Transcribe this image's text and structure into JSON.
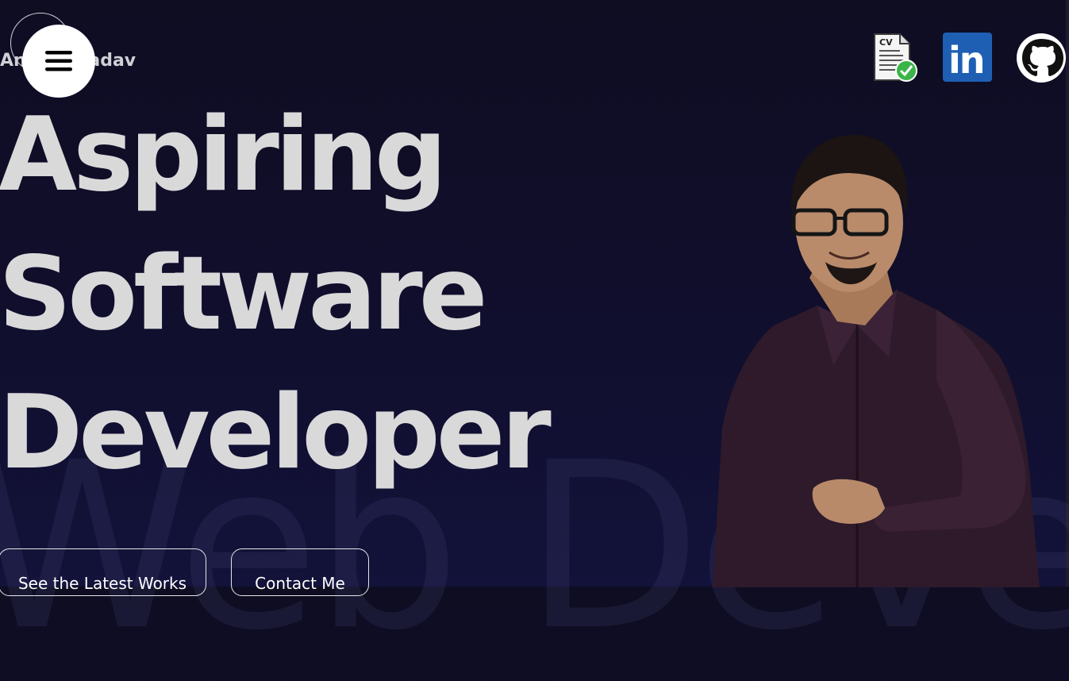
{
  "header": {
    "brand_name": "Anurag Yadav",
    "menu_icon": "hamburger-menu-icon",
    "icons": [
      {
        "name": "cv-download-icon",
        "label": "CV"
      },
      {
        "name": "linkedin-icon",
        "label": "in"
      },
      {
        "name": "github-icon"
      }
    ]
  },
  "hero": {
    "line1": "Aspiring",
    "line2": "Software",
    "line3": "Developer",
    "watermark": "Web Developer"
  },
  "actions": {
    "latest_works": "See the Latest Works",
    "contact": "Contact Me"
  },
  "portrait": {
    "name": "developer-portrait-photo"
  },
  "colors": {
    "background": "#0f0d22",
    "hero_text": "#d9d9da",
    "linkedin_blue": "#1e5fb4",
    "cv_check_green": "#3bb54a"
  }
}
